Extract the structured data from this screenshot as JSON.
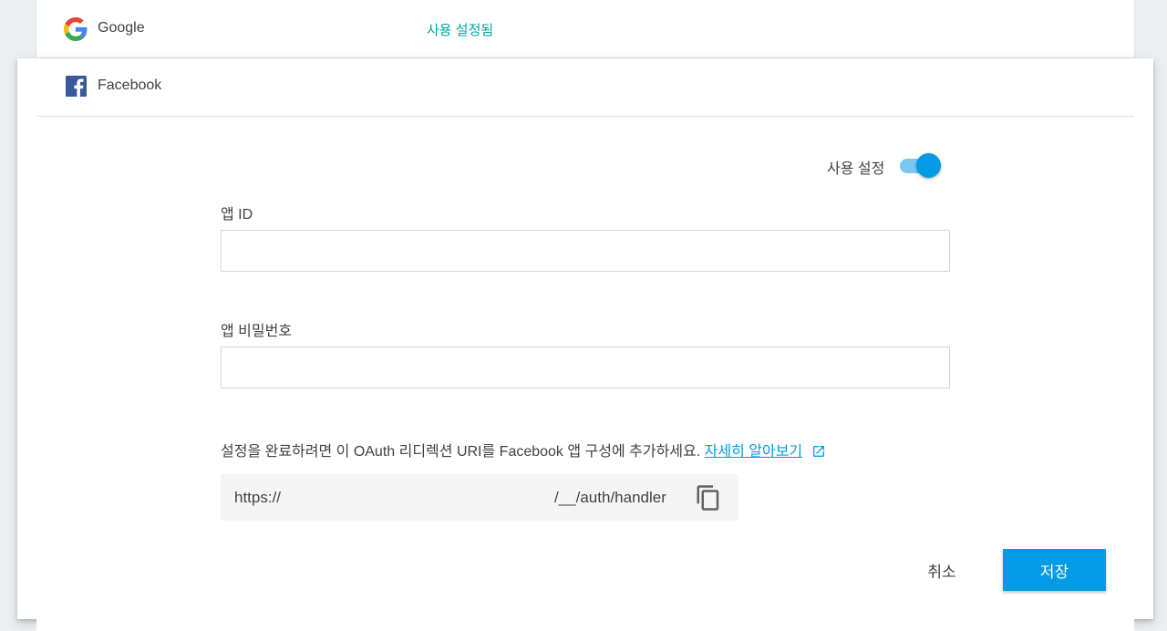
{
  "google_row": {
    "provider_name": "Google",
    "status": "사용 설정됨",
    "status_color": "#00a5a0",
    "icon": "google-logo"
  },
  "facebook_card": {
    "provider_name": "Facebook",
    "icon": "facebook-logo",
    "enable_label": "사용 설정",
    "enabled": true,
    "app_id": {
      "label": "앱 ID",
      "value": ""
    },
    "app_secret": {
      "label": "앱 비밀번호",
      "value": ""
    },
    "info_text": "설정을 완료하려면 이 OAuth 리디렉션 URI를 Facebook 앱 구성에 추가하세요.",
    "learn_more": "자세히 알아보기",
    "redirect_uri": {
      "prefix": "https://",
      "suffix": "/__/auth/handler"
    },
    "cancel_label": "취소",
    "save_label": "저장"
  },
  "colors": {
    "accent": "#039be5",
    "toggle_track": "#7cc6f2",
    "background": "#eceff1"
  }
}
